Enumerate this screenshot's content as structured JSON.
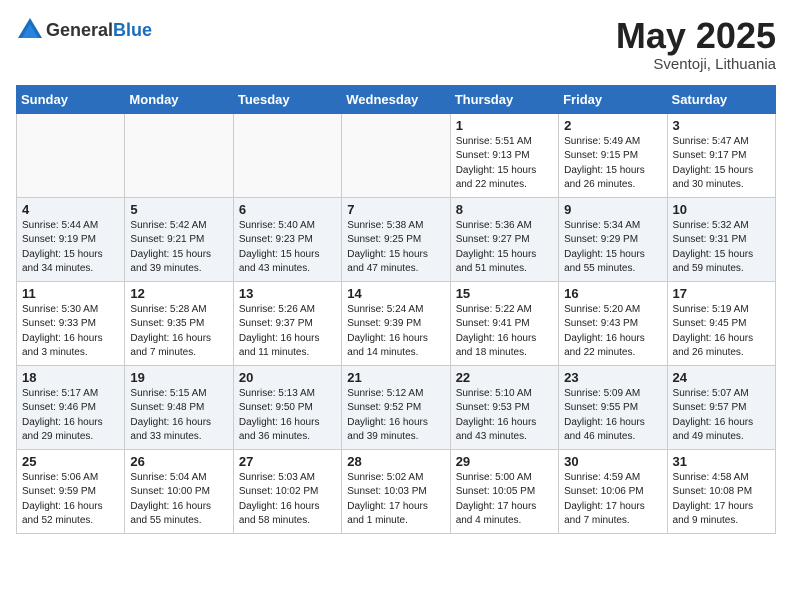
{
  "header": {
    "logo_general": "General",
    "logo_blue": "Blue",
    "month_title": "May 2025",
    "location": "Sventoji, Lithuania"
  },
  "weekdays": [
    "Sunday",
    "Monday",
    "Tuesday",
    "Wednesday",
    "Thursday",
    "Friday",
    "Saturday"
  ],
  "weeks": [
    [
      {
        "day": "",
        "info": ""
      },
      {
        "day": "",
        "info": ""
      },
      {
        "day": "",
        "info": ""
      },
      {
        "day": "",
        "info": ""
      },
      {
        "day": "1",
        "info": "Sunrise: 5:51 AM\nSunset: 9:13 PM\nDaylight: 15 hours\nand 22 minutes."
      },
      {
        "day": "2",
        "info": "Sunrise: 5:49 AM\nSunset: 9:15 PM\nDaylight: 15 hours\nand 26 minutes."
      },
      {
        "day": "3",
        "info": "Sunrise: 5:47 AM\nSunset: 9:17 PM\nDaylight: 15 hours\nand 30 minutes."
      }
    ],
    [
      {
        "day": "4",
        "info": "Sunrise: 5:44 AM\nSunset: 9:19 PM\nDaylight: 15 hours\nand 34 minutes."
      },
      {
        "day": "5",
        "info": "Sunrise: 5:42 AM\nSunset: 9:21 PM\nDaylight: 15 hours\nand 39 minutes."
      },
      {
        "day": "6",
        "info": "Sunrise: 5:40 AM\nSunset: 9:23 PM\nDaylight: 15 hours\nand 43 minutes."
      },
      {
        "day": "7",
        "info": "Sunrise: 5:38 AM\nSunset: 9:25 PM\nDaylight: 15 hours\nand 47 minutes."
      },
      {
        "day": "8",
        "info": "Sunrise: 5:36 AM\nSunset: 9:27 PM\nDaylight: 15 hours\nand 51 minutes."
      },
      {
        "day": "9",
        "info": "Sunrise: 5:34 AM\nSunset: 9:29 PM\nDaylight: 15 hours\nand 55 minutes."
      },
      {
        "day": "10",
        "info": "Sunrise: 5:32 AM\nSunset: 9:31 PM\nDaylight: 15 hours\nand 59 minutes."
      }
    ],
    [
      {
        "day": "11",
        "info": "Sunrise: 5:30 AM\nSunset: 9:33 PM\nDaylight: 16 hours\nand 3 minutes."
      },
      {
        "day": "12",
        "info": "Sunrise: 5:28 AM\nSunset: 9:35 PM\nDaylight: 16 hours\nand 7 minutes."
      },
      {
        "day": "13",
        "info": "Sunrise: 5:26 AM\nSunset: 9:37 PM\nDaylight: 16 hours\nand 11 minutes."
      },
      {
        "day": "14",
        "info": "Sunrise: 5:24 AM\nSunset: 9:39 PM\nDaylight: 16 hours\nand 14 minutes."
      },
      {
        "day": "15",
        "info": "Sunrise: 5:22 AM\nSunset: 9:41 PM\nDaylight: 16 hours\nand 18 minutes."
      },
      {
        "day": "16",
        "info": "Sunrise: 5:20 AM\nSunset: 9:43 PM\nDaylight: 16 hours\nand 22 minutes."
      },
      {
        "day": "17",
        "info": "Sunrise: 5:19 AM\nSunset: 9:45 PM\nDaylight: 16 hours\nand 26 minutes."
      }
    ],
    [
      {
        "day": "18",
        "info": "Sunrise: 5:17 AM\nSunset: 9:46 PM\nDaylight: 16 hours\nand 29 minutes."
      },
      {
        "day": "19",
        "info": "Sunrise: 5:15 AM\nSunset: 9:48 PM\nDaylight: 16 hours\nand 33 minutes."
      },
      {
        "day": "20",
        "info": "Sunrise: 5:13 AM\nSunset: 9:50 PM\nDaylight: 16 hours\nand 36 minutes."
      },
      {
        "day": "21",
        "info": "Sunrise: 5:12 AM\nSunset: 9:52 PM\nDaylight: 16 hours\nand 39 minutes."
      },
      {
        "day": "22",
        "info": "Sunrise: 5:10 AM\nSunset: 9:53 PM\nDaylight: 16 hours\nand 43 minutes."
      },
      {
        "day": "23",
        "info": "Sunrise: 5:09 AM\nSunset: 9:55 PM\nDaylight: 16 hours\nand 46 minutes."
      },
      {
        "day": "24",
        "info": "Sunrise: 5:07 AM\nSunset: 9:57 PM\nDaylight: 16 hours\nand 49 minutes."
      }
    ],
    [
      {
        "day": "25",
        "info": "Sunrise: 5:06 AM\nSunset: 9:59 PM\nDaylight: 16 hours\nand 52 minutes."
      },
      {
        "day": "26",
        "info": "Sunrise: 5:04 AM\nSunset: 10:00 PM\nDaylight: 16 hours\nand 55 minutes."
      },
      {
        "day": "27",
        "info": "Sunrise: 5:03 AM\nSunset: 10:02 PM\nDaylight: 16 hours\nand 58 minutes."
      },
      {
        "day": "28",
        "info": "Sunrise: 5:02 AM\nSunset: 10:03 PM\nDaylight: 17 hours\nand 1 minute."
      },
      {
        "day": "29",
        "info": "Sunrise: 5:00 AM\nSunset: 10:05 PM\nDaylight: 17 hours\nand 4 minutes."
      },
      {
        "day": "30",
        "info": "Sunrise: 4:59 AM\nSunset: 10:06 PM\nDaylight: 17 hours\nand 7 minutes."
      },
      {
        "day": "31",
        "info": "Sunrise: 4:58 AM\nSunset: 10:08 PM\nDaylight: 17 hours\nand 9 minutes."
      }
    ]
  ]
}
